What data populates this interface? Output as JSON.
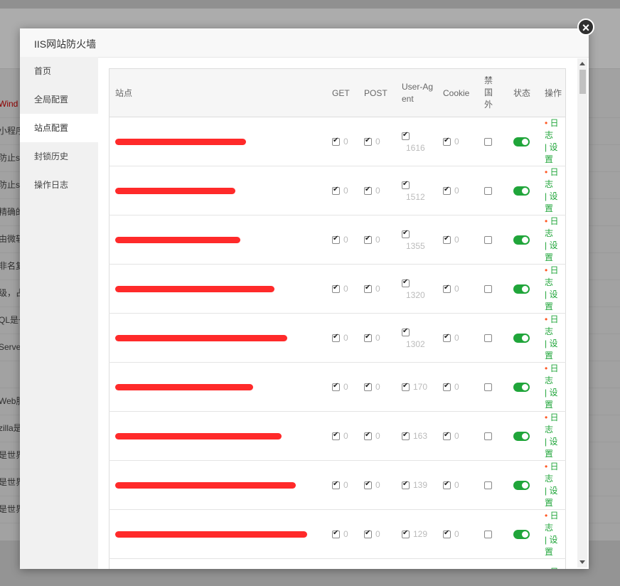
{
  "background_rows": [
    "Wind",
    "小程序",
    "防止s",
    "防止s",
    "精确的",
    "由微软",
    "非名复",
    "级，占",
    "QL是一",
    "Serve",
    "",
    "Web服",
    "zilla是",
    "是世界",
    "是世界",
    "是世界"
  ],
  "modal": {
    "title": "IIS网站防火墙",
    "close_symbol": "×"
  },
  "sidebar": {
    "items": [
      "首页",
      "全局配置",
      "站点配置",
      "封锁历史",
      "操作日志"
    ],
    "active_index": 2
  },
  "table": {
    "headers": {
      "site": "站点",
      "get": "GET",
      "post": "POST",
      "user_agent": "User-Agent",
      "cookie": "Cookie",
      "ban_foreign": "禁国外",
      "status": "状态",
      "action": "操作"
    },
    "action_labels": {
      "log": "日志",
      "sep": "|",
      "settings": "设置"
    },
    "rows": [
      {
        "get": "0",
        "post": "0",
        "ua": "1616",
        "ua_stacked": true,
        "cookie": "0",
        "status": true
      },
      {
        "get": "0",
        "post": "0",
        "ua": "1512",
        "ua_stacked": true,
        "cookie": "0",
        "status": true
      },
      {
        "get": "0",
        "post": "0",
        "ua": "1355",
        "ua_stacked": true,
        "cookie": "0",
        "status": true
      },
      {
        "get": "0",
        "post": "0",
        "ua": "1320",
        "ua_stacked": true,
        "cookie": "0",
        "status": true
      },
      {
        "get": "0",
        "post": "0",
        "ua": "1302",
        "ua_stacked": true,
        "cookie": "0",
        "status": true
      },
      {
        "get": "0",
        "post": "0",
        "ua": "170",
        "ua_stacked": false,
        "cookie": "0",
        "status": true
      },
      {
        "get": "0",
        "post": "0",
        "ua": "163",
        "ua_stacked": false,
        "cookie": "0",
        "status": true
      },
      {
        "get": "0",
        "post": "0",
        "ua": "139",
        "ua_stacked": false,
        "cookie": "0",
        "status": true
      },
      {
        "get": "0",
        "post": "0",
        "ua": "129",
        "ua_stacked": false,
        "cookie": "0",
        "status": true
      }
    ],
    "partial_row_action": "日志"
  },
  "colors": {
    "accent_green": "#20a53a",
    "dot_orange": "#ff5722",
    "redaction": "#ff2a2a"
  }
}
